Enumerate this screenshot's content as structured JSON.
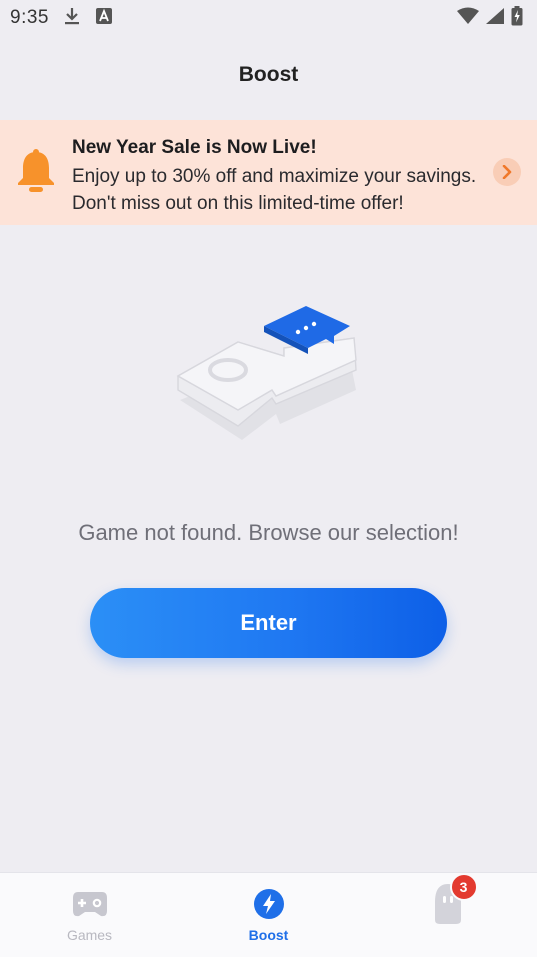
{
  "status_bar": {
    "time": "9:35",
    "left_icons": [
      "download-icon",
      "a-icon"
    ],
    "right_icons": [
      "wifi-icon",
      "signal-icon",
      "battery-charging-icon"
    ]
  },
  "header": {
    "title": "Boost"
  },
  "banner": {
    "title": "New Year Sale is Now Live!",
    "body": "Enjoy up to 30% off and maximize your savings. Don't miss out on this limited-time offer!",
    "icon": "bell-icon",
    "action_icon": "chevron-right-icon",
    "background": "#fde3d8",
    "accent": "#f7922b"
  },
  "empty_state": {
    "message": "Game not found. Browse our selection!",
    "button_label": "Enter",
    "button_color": "#1f78f2"
  },
  "bottom_nav": {
    "items": [
      {
        "label": "Games",
        "icon": "gamepad-icon",
        "active": false
      },
      {
        "label": "Boost",
        "icon": "lightning-icon",
        "active": true
      },
      {
        "label": "",
        "icon": "profile-icon",
        "active": false,
        "badge": "3"
      }
    ],
    "active_color": "#1f6fe8",
    "inactive_color": "#b8b8c0"
  }
}
